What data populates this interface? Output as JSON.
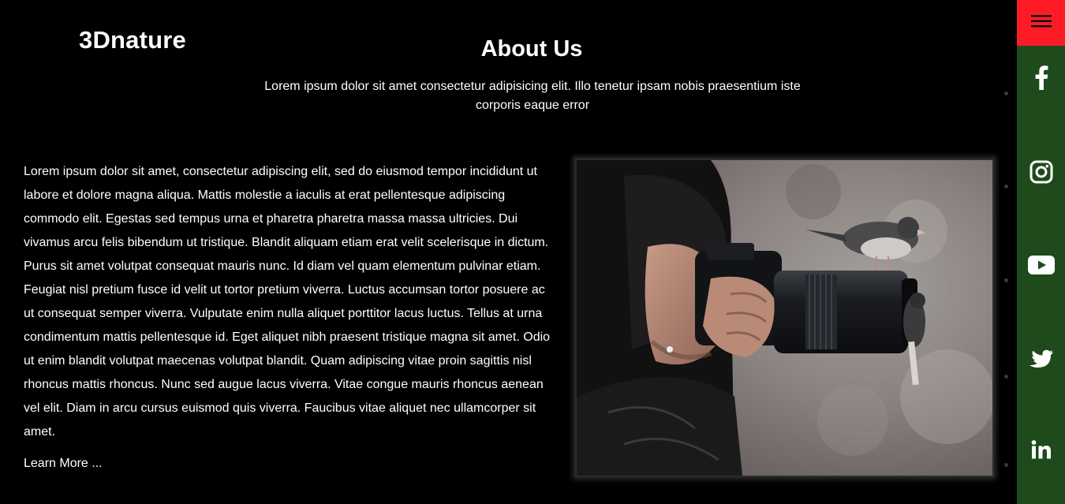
{
  "brand": {
    "logo": "3Dnature"
  },
  "about": {
    "title": "About Us",
    "subtitle": "Lorem ipsum dolor sit amet consectetur adipisicing elit. Illo tenetur ipsam nobis praesentium iste corporis eaque error"
  },
  "content": {
    "paragraph": "Lorem ipsum dolor sit amet, consectetur adipiscing elit, sed do eiusmod tempor incididunt ut labore et dolore magna aliqua. Mattis molestie a iaculis at erat pellentesque adipiscing commodo elit. Egestas sed tempus urna et pharetra pharetra massa massa ultricies. Dui vivamus arcu felis bibendum ut tristique. Blandit aliquam etiam erat velit scelerisque in dictum. Purus sit amet volutpat consequat mauris nunc. Id diam vel quam elementum pulvinar etiam. Feugiat nisl pretium fusce id velit ut tortor pretium viverra. Luctus accumsan tortor posuere ac ut consequat semper viverra. Vulputate enim nulla aliquet porttitor lacus luctus. Tellus at urna condimentum mattis pellentesque id. Eget aliquet nibh praesent tristique magna sit amet. Odio ut enim blandit volutpat maecenas volutpat blandit. Quam adipiscing vitae proin sagittis nisl rhoncus mattis rhoncus. Nunc sed augue lacus viverra. Vitae congue mauris rhoncus aenean vel elit. Diam in arcu cursus euismod quis viverra. Faucibus vitae aliquet nec ullamcorper sit amet.",
    "learn_more": "Learn More ..."
  },
  "sidebar": {
    "menu_icon": "hamburger-menu-icon",
    "social": [
      "facebook-icon",
      "instagram-icon",
      "youtube-icon",
      "twitter-icon",
      "linkedin-icon"
    ]
  },
  "colors": {
    "background": "#000000",
    "sidebar": "#1e4a1c",
    "menu_button": "#ff1b26",
    "text": "#ffffff"
  }
}
